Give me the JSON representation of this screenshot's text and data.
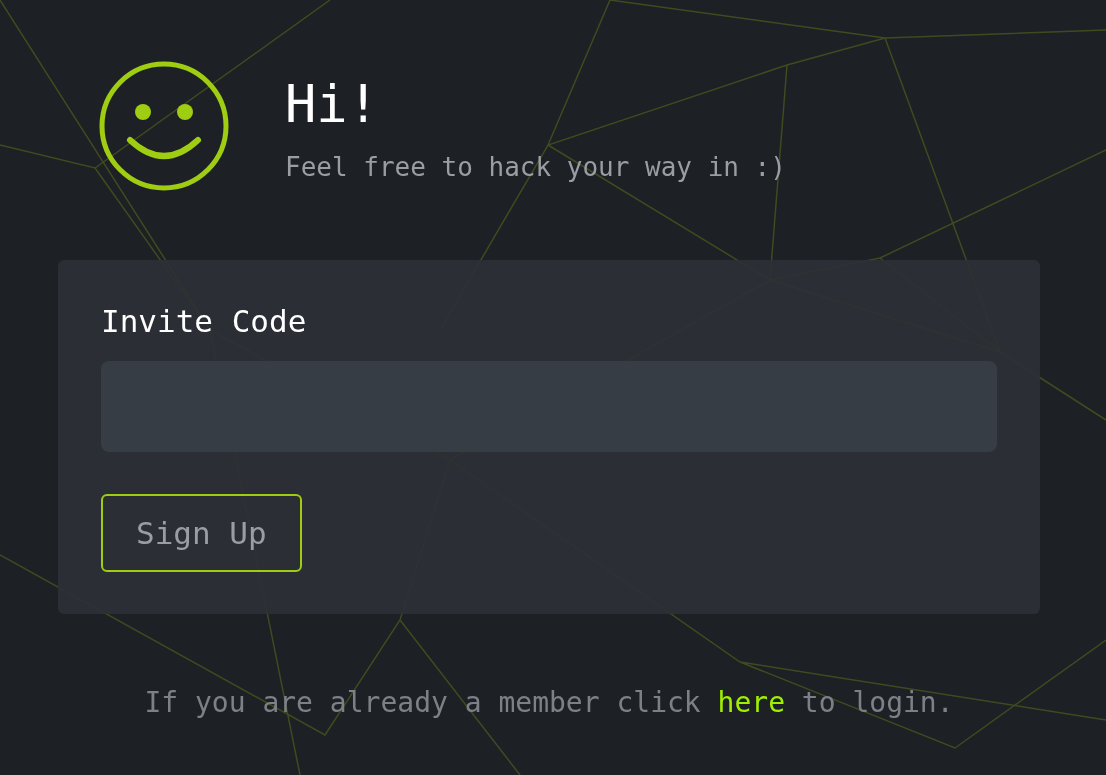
{
  "header": {
    "title": "Hi!",
    "subtitle": "Feel free to hack your way in :)"
  },
  "form": {
    "label": "Invite Code",
    "button": "Sign Up"
  },
  "footer": {
    "before": "If you are already a member click",
    "link": "here",
    "after": "to login."
  }
}
